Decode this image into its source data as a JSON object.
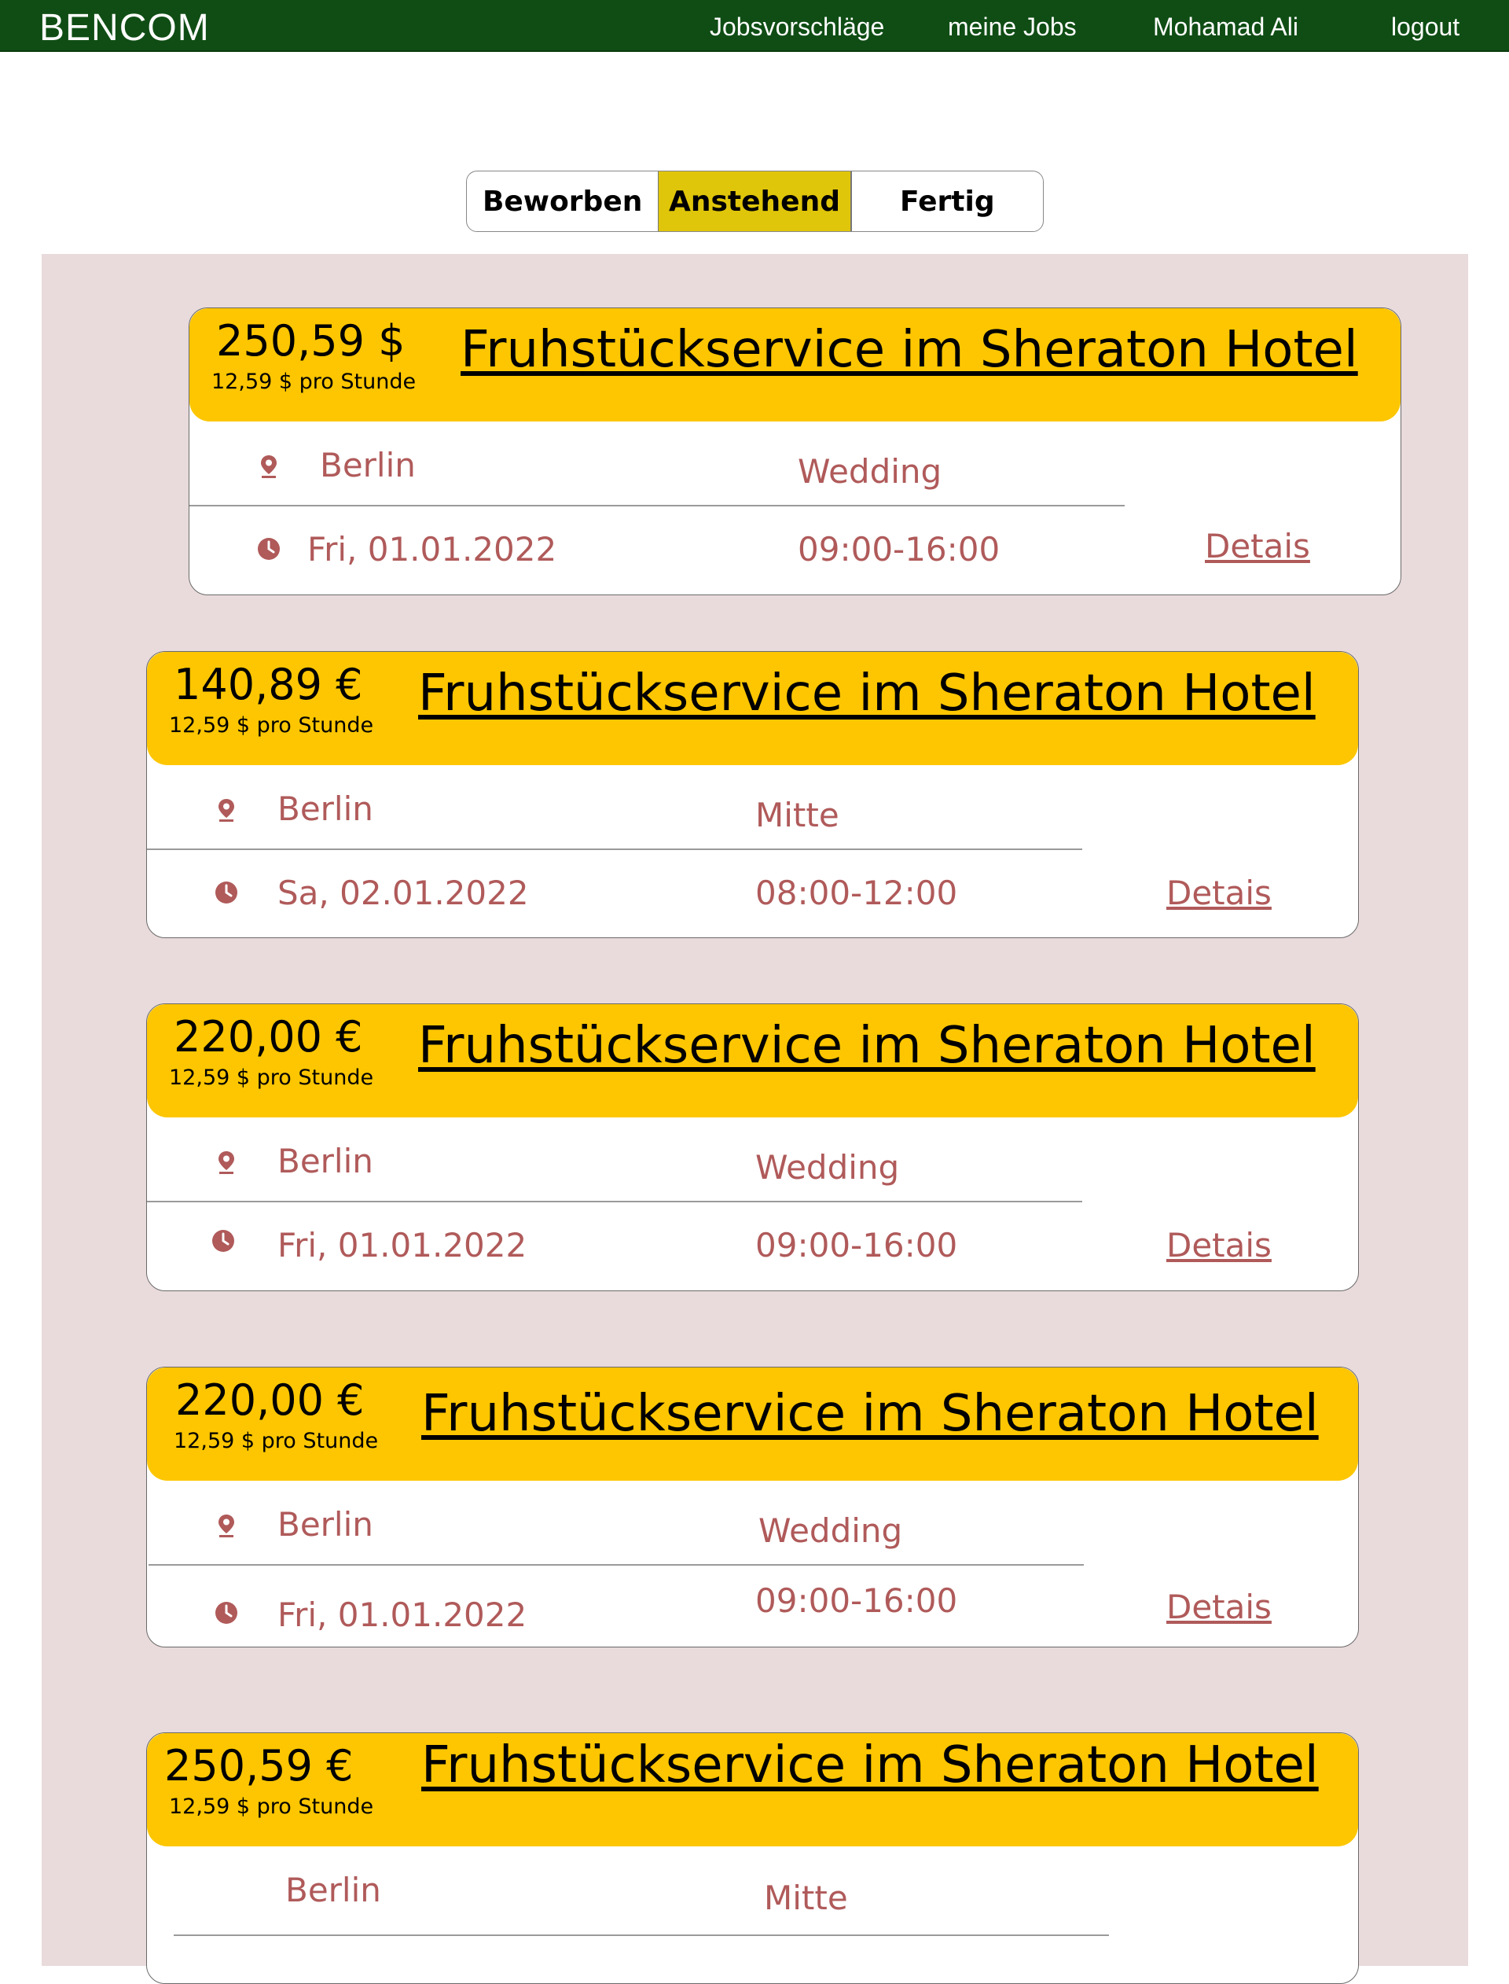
{
  "nav": {
    "brand": "BENCOM",
    "links": [
      "Jobsvorschläge",
      "meine Jobs",
      "Mohamad Ali",
      "logout"
    ]
  },
  "tabs": [
    {
      "label": "Beworben",
      "active": false
    },
    {
      "label": "Anstehend",
      "active": true
    },
    {
      "label": "Fertig",
      "active": false
    }
  ],
  "colors": {
    "navbar": "#0f4d14",
    "active_tab": "#e0c60a",
    "card_header": "#fdc600",
    "panel": "#e9dadb",
    "field_text": "#b05a5a"
  },
  "icons": {
    "location": "map-pin-icon",
    "time": "clock-icon"
  },
  "jobs": [
    {
      "price": "250,59 $",
      "rate": "12,59 $ pro Stunde",
      "title": "Fruhstückservice im Sheraton Hotel",
      "city": "Berlin",
      "district": "Wedding",
      "date": "Fri, 01.01.2022",
      "time": "09:00-16:00",
      "details": "Detais"
    },
    {
      "price": "140,89 €",
      "rate": "12,59 $ pro Stunde",
      "title": "Fruhstückservice im Sheraton Hotel",
      "city": "Berlin",
      "district": "Mitte",
      "date": "Sa, 02.01.2022",
      "time": "08:00-12:00",
      "details": "Detais"
    },
    {
      "price": "220,00 €",
      "rate": "12,59 $ pro Stunde",
      "title": "Fruhstückservice im Sheraton Hotel",
      "city": "Berlin",
      "district": "Wedding",
      "date": "Fri, 01.01.2022",
      "time": "09:00-16:00",
      "details": "Detais"
    },
    {
      "price": "220,00 €",
      "rate": "12,59 $ pro Stunde",
      "title": "Fruhstückservice im Sheraton Hotel",
      "city": "Berlin",
      "district": "Wedding",
      "date": "Fri, 01.01.2022",
      "time": "09:00-16:00",
      "details": "Detais"
    },
    {
      "price": "250,59 €",
      "rate": "12,59 $ pro Stunde",
      "title": "Fruhstückservice im Sheraton Hotel",
      "city": "Berlin",
      "district": "Mitte"
    }
  ]
}
